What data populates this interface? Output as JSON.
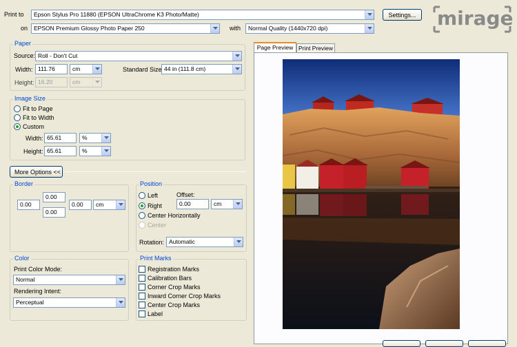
{
  "top": {
    "print_to_label": "Print to",
    "printer": "Epson Stylus Pro 11880 (EPSON UltraChrome K3 Photo/Matte)",
    "on_label": "on",
    "paper_type": "EPSON Premium Glossy Photo Paper 250",
    "with_label": "with",
    "quality": "Normal Quality (1440x720 dpi)",
    "settings_button": "Settings...",
    "logo": "mirage"
  },
  "paper": {
    "title": "Paper",
    "source_label": "Source:",
    "source": "Roll - Don't Cut",
    "width_label": "Width:",
    "width": "111.76",
    "width_unit": "cm",
    "standard_size_label": "Standard Size:",
    "standard_size": "44 in (111.8 cm)",
    "height_label": "Height:",
    "height": "16.20",
    "height_unit": "cm"
  },
  "image_size": {
    "title": "Image Size",
    "fit_page": "Fit to Page",
    "fit_width": "Fit to Width",
    "custom": "Custom",
    "width_label": "Width:",
    "width": "65.61",
    "width_unit": "%",
    "height_label": "Height:",
    "height": "65.61",
    "height_unit": "%"
  },
  "more_options": "More Options <<",
  "border": {
    "title": "Border",
    "left": "0.00",
    "top": "0.00",
    "bottom": "0.00",
    "right": "0.00",
    "unit": "cm"
  },
  "position": {
    "title": "Position",
    "left": "Left",
    "right": "Right",
    "center_h": "Center Horizontally",
    "center": "Center",
    "offset_label": "Offset:",
    "offset": "0.00",
    "offset_unit": "cm",
    "rotation_label": "Rotation:",
    "rotation": "Automatic"
  },
  "color": {
    "title": "Color",
    "mode_label": "Print Color Mode:",
    "mode": "Normal",
    "intent_label": "Rendering Intent:",
    "intent": "Perceptual"
  },
  "marks": {
    "title": "Print Marks",
    "items": [
      "Registration Marks",
      "Calibration Bars",
      "Corner Crop Marks",
      "Inward Corner Crop Marks",
      "Center Crop Marks",
      "Label"
    ]
  },
  "tabs": {
    "page_preview": "Page Preview",
    "print_preview": "Print Preview"
  },
  "colors": {
    "accent": "#0046d5",
    "tab_highlight": "#e68b2c"
  }
}
